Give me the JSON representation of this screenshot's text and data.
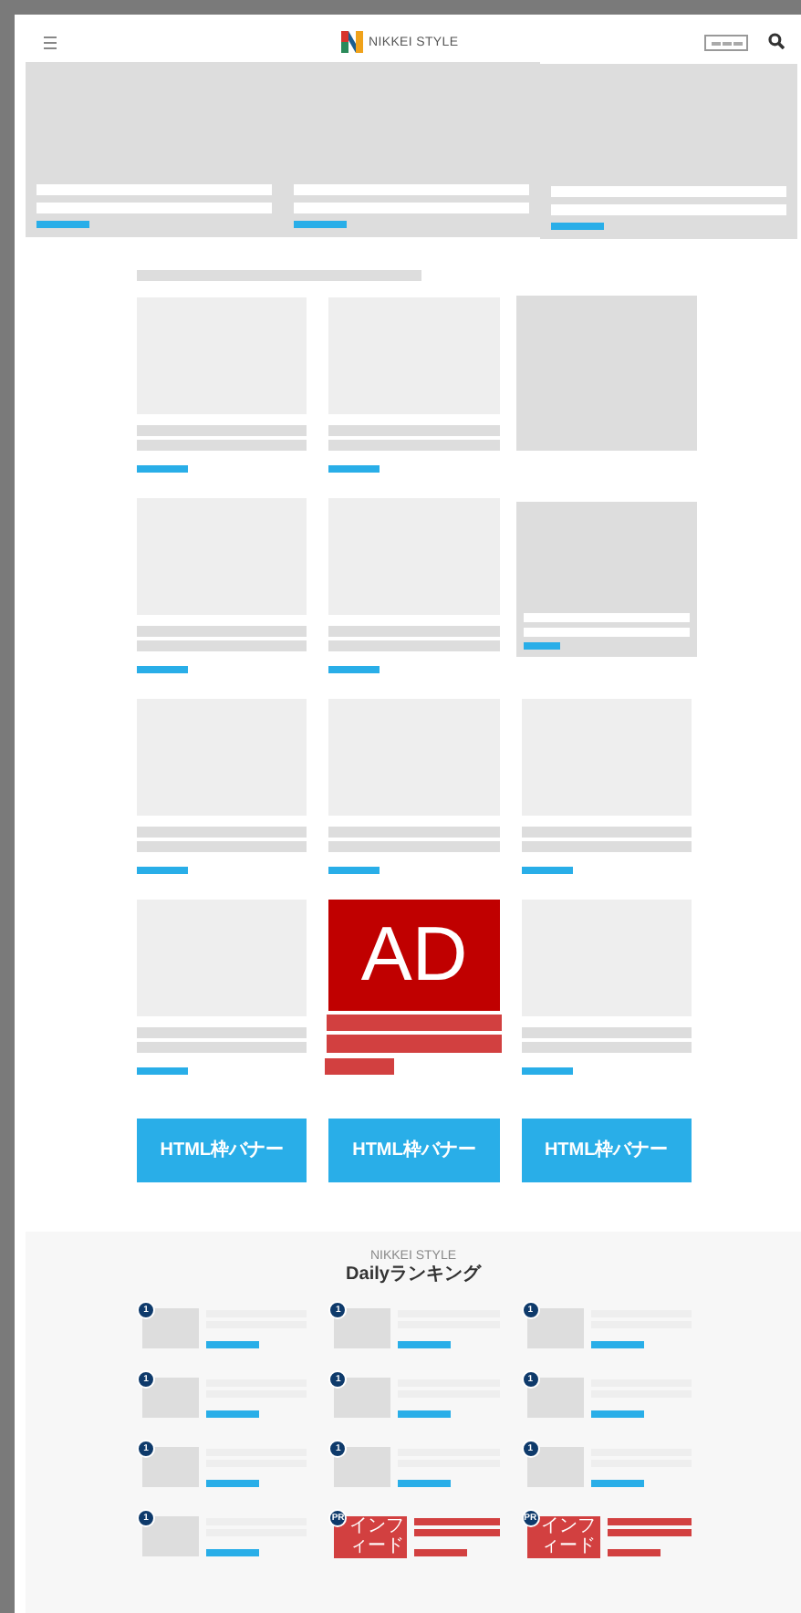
{
  "header": {
    "logo": "NIKKEI STYLE"
  },
  "hero": {
    "slides": [
      {
        "kind": "slide"
      },
      {
        "kind": "slide"
      },
      {
        "kind": "slide"
      }
    ]
  },
  "grid": {
    "cards": [
      {
        "kind": "article"
      },
      {
        "kind": "article"
      },
      {
        "kind": "box"
      },
      {
        "kind": "article"
      },
      {
        "kind": "article"
      },
      {
        "kind": "box-text"
      },
      {
        "kind": "article"
      },
      {
        "kind": "article"
      },
      {
        "kind": "article"
      },
      {
        "kind": "article"
      },
      {
        "kind": "ad",
        "label": "AD"
      },
      {
        "kind": "article"
      }
    ]
  },
  "banners": [
    {
      "label": "HTML枠バナー"
    },
    {
      "label": "HTML枠バナー"
    },
    {
      "label": "HTML枠バナー"
    }
  ],
  "ranking": {
    "brand": "NIKKEI STYLE",
    "title": "Dailyランキング",
    "items": [
      {
        "kind": "article",
        "badge": "1"
      },
      {
        "kind": "article",
        "badge": "1"
      },
      {
        "kind": "article",
        "badge": "1"
      },
      {
        "kind": "article",
        "badge": "1"
      },
      {
        "kind": "article",
        "badge": "1"
      },
      {
        "kind": "article",
        "badge": "1"
      },
      {
        "kind": "article",
        "badge": "1"
      },
      {
        "kind": "article",
        "badge": "1"
      },
      {
        "kind": "article",
        "badge": "1"
      },
      {
        "kind": "article",
        "badge": "1"
      },
      {
        "kind": "infeed",
        "badge": "PR",
        "label": "インフィード"
      },
      {
        "kind": "infeed",
        "badge": "PR",
        "label": "インフィード"
      }
    ]
  }
}
